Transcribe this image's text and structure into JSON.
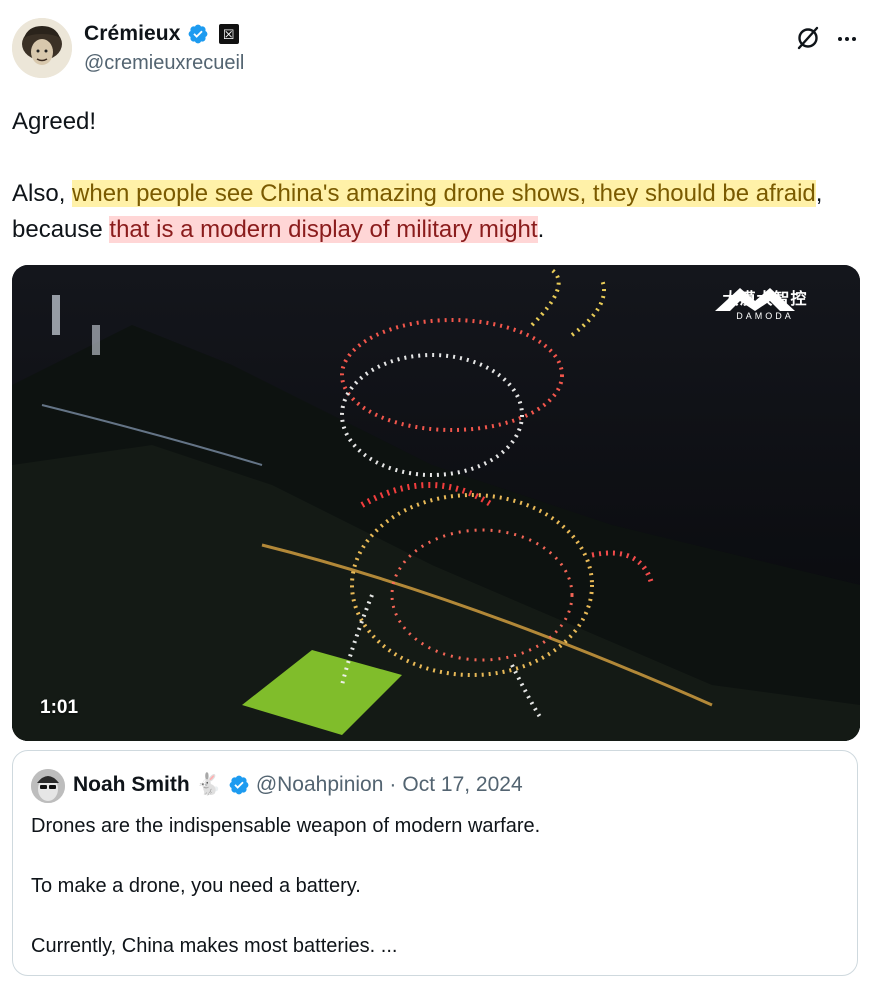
{
  "author": {
    "display_name": "Crémieux",
    "handle": "@cremieuxrecueil",
    "verified": true,
    "affiliation_badge": "☒"
  },
  "tweet": {
    "line1": "Agreed!",
    "line2_prefix": "Also, ",
    "highlight_yellow": "when people see China's amazing drone shows, they should be afraid",
    "middle": ", because ",
    "highlight_red": "that is a modern display of military might",
    "suffix": "."
  },
  "media": {
    "duration": "1:01",
    "watermark_cn": "大漠大智控",
    "watermark_en": "DAMODA"
  },
  "quoted_tweet": {
    "display_name": "Noah Smith",
    "emoji": "🐇",
    "handle": "@Noahpinion",
    "separator": "·",
    "date": "Oct 17, 2024",
    "paragraphs": [
      "Drones are the indispensable weapon of modern warfare.",
      "To make a drone, you need a battery.",
      "Currently, China makes most batteries. ..."
    ]
  },
  "colors": {
    "text": "#0f1419",
    "secondary": "#536471",
    "verified_blue": "#1d9bf0",
    "highlight_yellow": "#fff1a8",
    "highlight_red": "#ffd6d6"
  },
  "icons": [
    "verified-badge-icon",
    "grok-icon",
    "more-options-icon"
  ]
}
